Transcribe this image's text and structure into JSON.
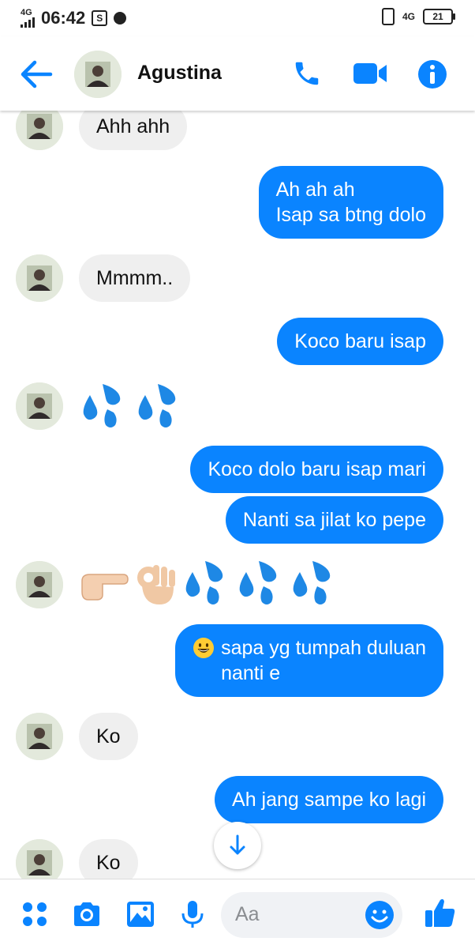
{
  "status_bar": {
    "network_left": "4G",
    "time": "06:42",
    "network_right": "4G",
    "battery": "21"
  },
  "header": {
    "contact_name": "Agustina"
  },
  "messages": [
    {
      "from": "contact",
      "text": "Ahh ahh"
    },
    {
      "from": "me",
      "text": "Ah ah ah\nIsap sa btng dolo"
    },
    {
      "from": "contact",
      "text": "Mmmm.."
    },
    {
      "from": "me",
      "text": "Koco baru isap"
    },
    {
      "from": "contact",
      "emoji": [
        "sweat-droplets",
        "sweat-droplets"
      ]
    },
    {
      "from": "me",
      "text": "Koco dolo baru isap mari"
    },
    {
      "from": "me",
      "text": "Nanti sa jilat ko pepe"
    },
    {
      "from": "contact",
      "emoji": [
        "pointing-hand",
        "ok-hand",
        "sweat-droplets",
        "sweat-droplets",
        "sweat-droplets"
      ]
    },
    {
      "from": "me",
      "text": "sapa yg tumpah duluan\nnanti e",
      "prefix_emoji": "grinning-face"
    },
    {
      "from": "contact",
      "text": "Ko"
    },
    {
      "from": "me",
      "text": "Ah jang sampe ko lagi"
    },
    {
      "from": "contact",
      "text": "Ko"
    }
  ],
  "composer": {
    "placeholder": "Aa"
  },
  "colors": {
    "accent": "#0a84ff",
    "incoming_bubble": "#efefef"
  }
}
